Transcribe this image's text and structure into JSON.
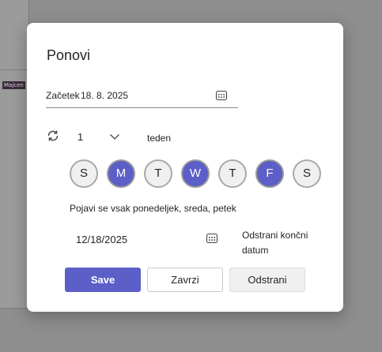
{
  "background": {
    "chip_text": "Majcen"
  },
  "dialog": {
    "title": "Ponovi",
    "start": {
      "label": "Začetek",
      "value": "18. 8. 2025",
      "icon": "calendar-icon"
    },
    "repeat": {
      "icon": "repeat-icon",
      "count": "1",
      "unit": "teden"
    },
    "days": [
      {
        "label": "S",
        "selected": false
      },
      {
        "label": "M",
        "selected": true
      },
      {
        "label": "T",
        "selected": false
      },
      {
        "label": "W",
        "selected": true
      },
      {
        "label": "T",
        "selected": false
      },
      {
        "label": "F",
        "selected": true
      },
      {
        "label": "S",
        "selected": false
      }
    ],
    "summary": "Pojavi se vsak ponedeljek, sreda, petek",
    "end": {
      "value": "12/18/2025",
      "icon": "calendar-icon",
      "remove_label": "Odstrani končni datum"
    },
    "buttons": {
      "save": "Save",
      "discard": "Zavrzi",
      "remove": "Odstrani"
    }
  },
  "colors": {
    "accent": "#5b5fc7",
    "overlay": "#8c8c8c"
  }
}
